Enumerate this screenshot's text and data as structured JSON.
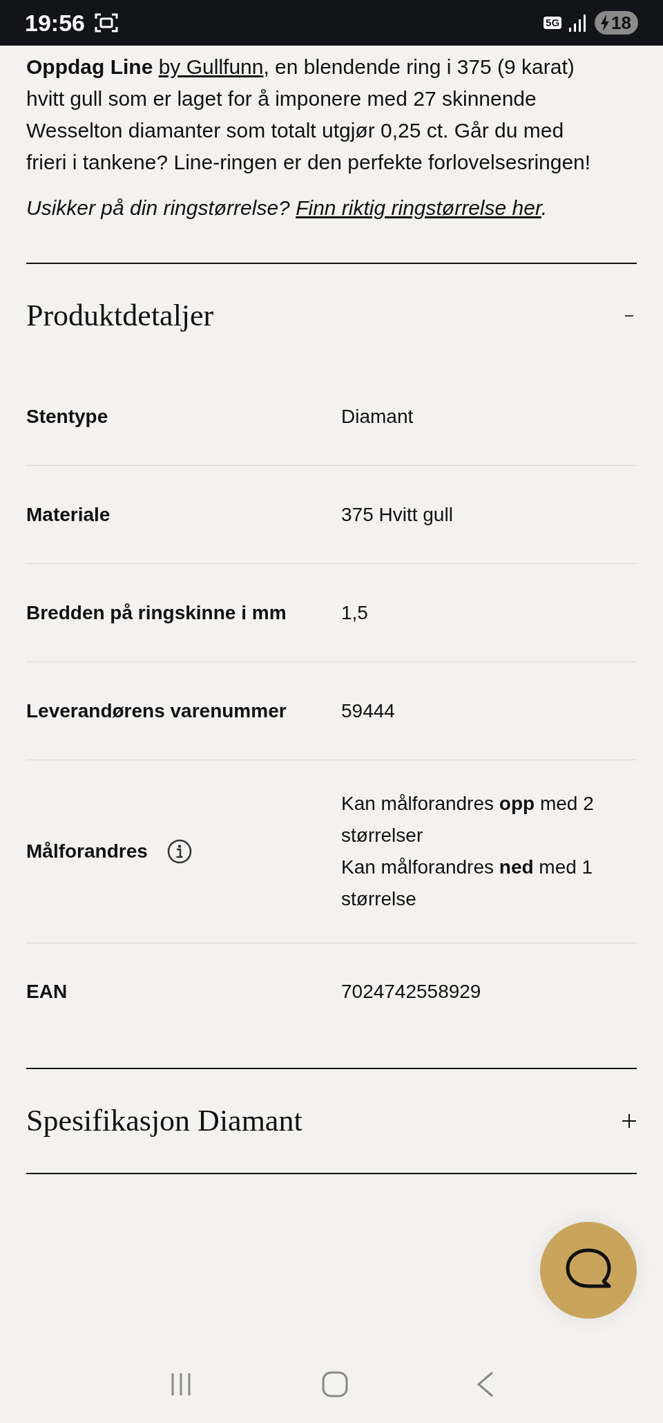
{
  "status_bar": {
    "time": "19:56",
    "network": "5G",
    "battery": "18"
  },
  "intro": {
    "segments": [
      {
        "kind": "text",
        "text": "**Oppdag Line** "
      },
      {
        "kind": "link",
        "text": "by Gullfunn"
      },
      {
        "kind": "text",
        "text": ", en blendende ring i 375 (9 karat) hvitt gull som er laget for å imponere med 27 skinnende Wesselton diamanter som totalt utgjør 0,25 ct. Går du med frieri i tankene? Line-ringen er den perfekte forlovelsesringen!"
      }
    ]
  },
  "size_hint": {
    "segments": [
      {
        "kind": "text",
        "text": "Usikker på din ringstørrelse? "
      },
      {
        "kind": "link",
        "text": "Finn riktig ringstørrelse her"
      },
      {
        "kind": "text",
        "text": "."
      }
    ]
  },
  "accordions": [
    {
      "title": "Produktdetaljer",
      "expanded": true,
      "rows": [
        {
          "label": "Stentype",
          "value_lines": [
            "Diamant"
          ]
        },
        {
          "label": "Materiale",
          "value_lines": [
            "375 Hvitt gull"
          ]
        },
        {
          "label": "Bredden på ringskinne i mm",
          "value_lines": [
            "1,5"
          ]
        },
        {
          "label": "Leverandørens varenummer",
          "value_lines": [
            "59444"
          ]
        },
        {
          "label": "Målforandres",
          "info": true,
          "value_lines": [
            "Kan målforandres **opp** med 2 størrelser",
            "Kan målforandres **ned** med 1 størrelse"
          ]
        },
        {
          "label": "EAN",
          "value_lines": [
            "7024742558929"
          ]
        }
      ]
    },
    {
      "title": "Spesifikasjon Diamant",
      "expanded": false
    }
  ]
}
